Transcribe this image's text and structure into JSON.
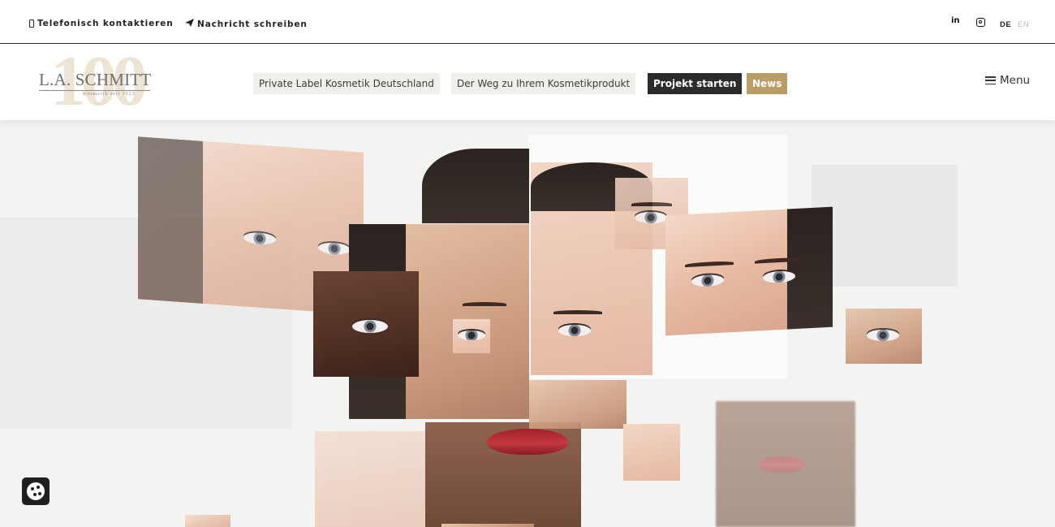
{
  "topbar": {
    "phone_label": "Telefonisch kontaktieren",
    "message_label": "Nachricht schreiben",
    "linkedin_label": "in",
    "lang_de": "DE",
    "lang_en": "EN"
  },
  "header": {
    "logo_brand": "L.A. SCHMITT",
    "logo_since": "Kosmetik seit 1923",
    "logo_badge": "100",
    "nav": [
      {
        "label": "Private Label Kosmetik Deutschland"
      },
      {
        "label": "Der Weg zu Ihrem Kosmetikprodukt"
      },
      {
        "label": "Projekt starten"
      },
      {
        "label": "News"
      }
    ],
    "menu_label": "Menu"
  },
  "colors": {
    "accent_gold": "#b99c66",
    "dark_button": "#2c2c2c",
    "nav_bg": "#f0efec"
  },
  "icons": [
    "phone-icon",
    "paper-plane-icon",
    "linkedin-icon",
    "instagram-icon",
    "hamburger-icon",
    "cookie-icon"
  ]
}
